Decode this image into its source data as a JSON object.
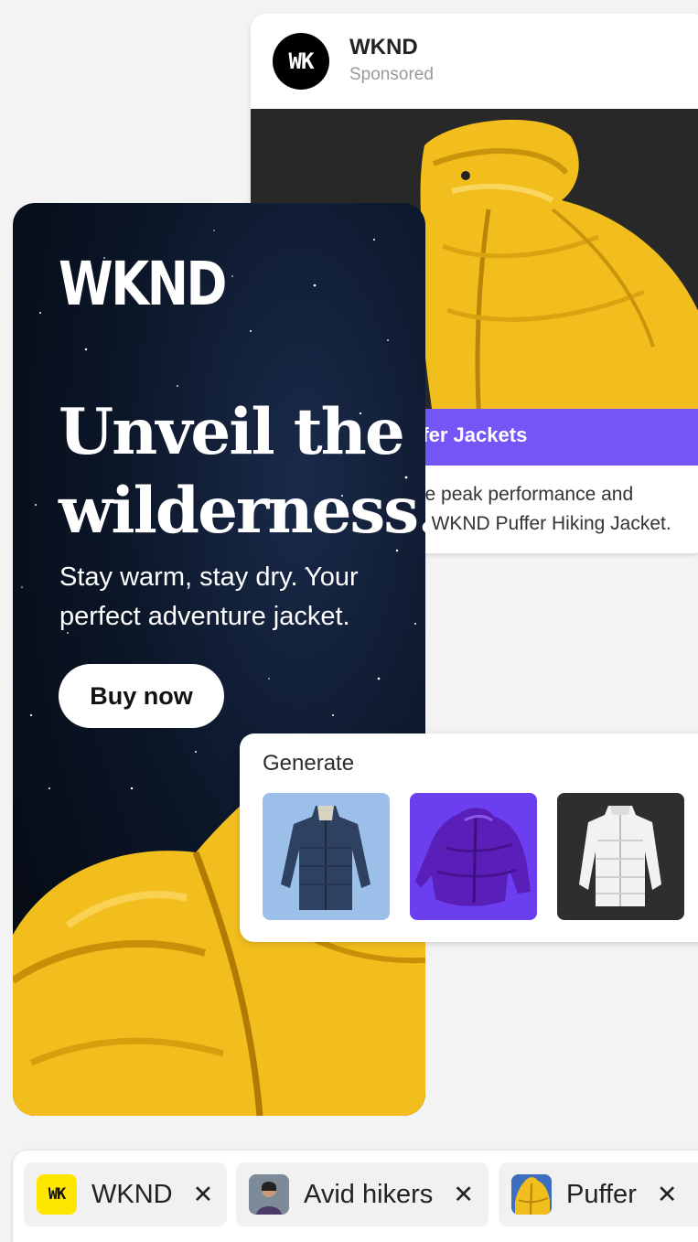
{
  "post": {
    "avatar_text": "WK",
    "brand": "WKND",
    "sponsored": "Sponsored",
    "band_title": "ffer Jackets",
    "body_line1": "ce peak performance and",
    "body_line2": "e WKND Puffer Hiking Jacket."
  },
  "ad": {
    "logo": "WKND",
    "headline_line1": "Unveil the",
    "headline_line2": "wilderness.",
    "sub_line1": "Stay warm, stay dry. Your",
    "sub_line2": "perfect adventure jacket.",
    "cta": "Buy now"
  },
  "generate": {
    "title": "Generate",
    "thumbnails": [
      {
        "name": "navy-parka",
        "bg": "#9cc0ea",
        "jacket": "#2f4160"
      },
      {
        "name": "purple-puffer",
        "bg": "#6b3ff0",
        "jacket": "#5a1fb8"
      },
      {
        "name": "white-puffer",
        "bg": "#2e2e2e",
        "jacket": "#f2f2f2"
      }
    ]
  },
  "tags": [
    {
      "label": "WKND",
      "icon_text": "WK"
    },
    {
      "label": "Avid hikers"
    },
    {
      "label": "Puffer"
    }
  ],
  "colors": {
    "accent_purple": "#7356f5",
    "jacket_yellow": "#f2be1d",
    "tag_yellow": "#ffe600"
  }
}
